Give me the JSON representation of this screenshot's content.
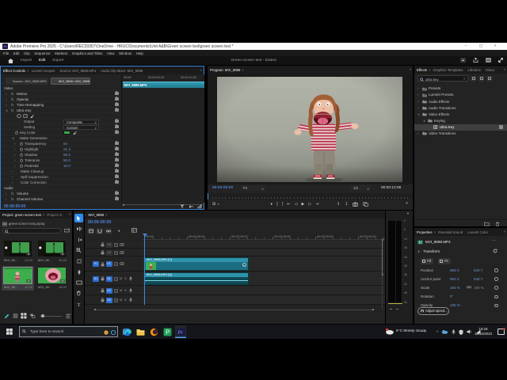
{
  "window": {
    "title": "Adobe Premiere Pro 2025 - C:\\Users\\REC03357\\OneDrive - HRUC\\Documents\\Unit A&B\\Green screen test\\green screen test *",
    "minimize": "–",
    "maximize": "▢",
    "close": "×"
  },
  "menu_bar": {
    "items": [
      "File",
      "Edit",
      "Clip",
      "Sequence",
      "Markers",
      "Graphics and Titles",
      "View",
      "Window",
      "Help"
    ]
  },
  "workspace_bar": {
    "tabs": [
      {
        "label": "Import",
        "active": false
      },
      {
        "label": "Edit",
        "active": true
      },
      {
        "label": "Export",
        "active": false
      }
    ],
    "document_title": "Green screen test - Edited"
  },
  "effect_controls": {
    "tabs": [
      {
        "label": "Effect Controls",
        "active": true
      },
      {
        "label": "Lumetri Scopes",
        "active": false
      },
      {
        "label": "Source: MVI_9898.MP4",
        "active": false
      },
      {
        "label": "Audio Clip Mixer: MVI_9898",
        "active": false
      }
    ],
    "source_button": "Source • MVI_9898.MP4",
    "clip_button": "MVI_9898 • MVI_9898.MP4",
    "rows": [
      {
        "type": "section",
        "label": "Video"
      },
      {
        "type": "effect",
        "label": "Motion"
      },
      {
        "type": "effect",
        "label": "Opacity"
      },
      {
        "type": "effect",
        "label": "Time Remapping"
      },
      {
        "type": "effect",
        "label": "Ultra Key",
        "expanded": true
      },
      {
        "type": "icons"
      },
      {
        "type": "dropdown",
        "label": "Output",
        "value": "Composite"
      },
      {
        "type": "dropdown",
        "label": "Setting",
        "value": "Custom"
      },
      {
        "type": "color",
        "label": "Key Color"
      },
      {
        "type": "group",
        "label": "Matte Generation"
      },
      {
        "type": "param",
        "label": "Transparency",
        "value": "64"
      },
      {
        "type": "param",
        "label": "Highlight",
        "value": "21.4"
      },
      {
        "type": "param",
        "label": "Shadow",
        "value": "50.0"
      },
      {
        "type": "param",
        "label": "Tolerance",
        "value": "50.0"
      },
      {
        "type": "param",
        "label": "Pedestal",
        "value": "10.0"
      },
      {
        "type": "group2",
        "label": "Matte Cleanup"
      },
      {
        "type": "group2",
        "label": "Spill Suppression"
      },
      {
        "type": "group2",
        "label": "Color Correction"
      },
      {
        "type": "section",
        "label": "Audio"
      },
      {
        "type": "effect",
        "label": "Volume"
      },
      {
        "type": "effect",
        "label": "Channel Volume"
      }
    ],
    "key_color": "#3aa84a",
    "mini_timeline": {
      "ruler": [
        "00:00",
        "00:00:05:00",
        "00:00:10:00"
      ],
      "clip_label": "MVI_9898.MP4"
    },
    "timecode": "00:00:00:00"
  },
  "program_monitor": {
    "tab": "Program: MVI_9898",
    "current_time": "00:00:00:00",
    "zoom_level": "Fit",
    "playback_resolution": "1/2",
    "duration": "00:00:12:06",
    "transport_center": [
      "add-marker",
      "mark-in",
      "mark-out",
      "go-to-in",
      "step-back",
      "play",
      "step-forward",
      "go-to-out"
    ],
    "transport_right": [
      "lift",
      "extract",
      "export-frame",
      "comparison-view"
    ]
  },
  "effects_panel": {
    "tabs": [
      {
        "label": "Effects",
        "active": true
      },
      {
        "label": "Graphics Templates",
        "active": false
      },
      {
        "label": "Libraries",
        "active": false
      },
      {
        "label": "Histor",
        "active": false
      }
    ],
    "search_value": "ultra key",
    "tree": [
      {
        "label": "Presets",
        "depth": 0,
        "icon": "folder-special",
        "chevron": "right"
      },
      {
        "label": "Lumetri Presets",
        "depth": 0,
        "icon": "folder-special",
        "chevron": "right"
      },
      {
        "label": "Audio Effects",
        "depth": 0,
        "icon": "folder",
        "chevron": "right"
      },
      {
        "label": "Audio Transitions",
        "depth": 0,
        "icon": "folder",
        "chevron": "right"
      },
      {
        "label": "Video Effects",
        "depth": 0,
        "icon": "folder",
        "chevron": "down"
      },
      {
        "label": "Keying",
        "depth": 1,
        "icon": "folder",
        "chevron": "down"
      },
      {
        "label": "Ultra Key",
        "depth": 2,
        "icon": "effect",
        "selected": true,
        "badge": true
      },
      {
        "label": "Video Transitions",
        "depth": 0,
        "icon": "folder",
        "chevron": "right"
      }
    ]
  },
  "properties_panel": {
    "tabs": [
      {
        "label": "Properties",
        "active": true
      },
      {
        "label": "Essential Sound",
        "active": false
      },
      {
        "label": "Lumetri Color",
        "active": false
      }
    ],
    "clip_name": "MVI_9898.MP4",
    "section": "Transform",
    "fill_button": "Fill",
    "fit_button": "Fit",
    "rows": [
      {
        "label": "Position",
        "values": [
          {
            "v": "960 X"
          },
          {
            "v": "540 Y"
          }
        ]
      },
      {
        "label": "Anchor point",
        "values": [
          {
            "v": "960 X"
          },
          {
            "v": "540 Y"
          }
        ]
      },
      {
        "label": "Scale",
        "values": [
          {
            "v": "100 %"
          },
          {
            "v": "100 %",
            "muted": true
          }
        ],
        "link": true
      },
      {
        "label": "Rotation",
        "values": [
          {
            "v": "0°"
          }
        ]
      },
      {
        "label": "Opacity",
        "values": [
          {
            "v": "100 %"
          }
        ]
      }
    ],
    "adjust_speed_button": "Adjust speed..."
  },
  "project_panel": {
    "tabs": [
      {
        "label": "Project: green screen test",
        "active": true
      },
      {
        "label": "Project: G",
        "active": false
      }
    ],
    "file_name": "green screen test.prproj",
    "items": [
      {
        "name": "MVI_98...",
        "duration": "11:04",
        "kind": "stage",
        "selected": false
      },
      {
        "name": "MVI_98...",
        "duration": "16:40",
        "kind": "stage",
        "selected": false
      },
      {
        "name": "MVI_98...",
        "duration": "12:06",
        "kind": "puppet",
        "selected": true
      },
      {
        "name": "MVI_98...",
        "duration": "16:00",
        "kind": "mouth",
        "selected": false
      }
    ]
  },
  "tools": [
    "selection",
    "track-select-forward",
    "ripple-edit",
    "razor",
    "slip",
    "pen",
    "rectangle",
    "hand",
    "type"
  ],
  "timeline": {
    "tab": "MVI_9898",
    "timecode": "00:00:00:00",
    "ruler": [
      "00:00",
      "00:00:05:00",
      "00:00:10:00",
      "00:00:15:00",
      "00:00:20:00",
      "00:00:25:00"
    ],
    "tracks": [
      {
        "name": "V3",
        "kind": "video",
        "patch": "",
        "target": ""
      },
      {
        "name": "V2",
        "kind": "video",
        "patch": "",
        "target": ""
      },
      {
        "name": "V1",
        "kind": "video",
        "patch": "V1",
        "target": "V1",
        "clip": "MVI_9898.MP4 [V]"
      },
      {
        "name": "A1",
        "kind": "audio",
        "patch": "A1",
        "target": "A1",
        "clip": "MVI_9898.MP4 [A]"
      },
      {
        "name": "A2",
        "kind": "audio",
        "patch": "",
        "target": "A2"
      },
      {
        "name": "A3",
        "kind": "audio",
        "patch": "",
        "target": "A3"
      }
    ]
  },
  "audio_meter": {
    "labels": [
      "0",
      "6",
      "12",
      "18",
      "24",
      "30",
      "36",
      "42",
      "48",
      "54"
    ]
  },
  "taskbar": {
    "search_placeholder": "Type here to search",
    "apps": [
      "edge",
      "file-explorer",
      "firefox",
      "green-app",
      "premiere-pro"
    ],
    "weather": "6°C Mostly cloudy",
    "time": "18:18",
    "date": "13/10/2023"
  },
  "icons": {
    "menu": "≡",
    "overflow": "»",
    "chevron_down": "∨",
    "chevron_right": "›",
    "close": "×",
    "more": "⋯",
    "caret_down": "▼",
    "caret_up": "^",
    "add_marker": "♦",
    "mark_in": "{",
    "mark_out": "}",
    "go_to_in": "⇤",
    "step_back": "◁",
    "play": "▶",
    "step_forward": "▷",
    "go_to_out": "⇥",
    "lift": "↥",
    "extract": "↧",
    "plus": "+"
  },
  "colors": {
    "accent_blue": "#2d8ceb",
    "value_blue": "#6a9bd4",
    "timecode_blue": "#4f83d9",
    "clip_teal": "#2e93ab",
    "render_bar_yellow": "#cdc558",
    "key_color_green": "#3aa84a",
    "chroma_green": "#3fae4e",
    "panel_bg": "#232323"
  }
}
